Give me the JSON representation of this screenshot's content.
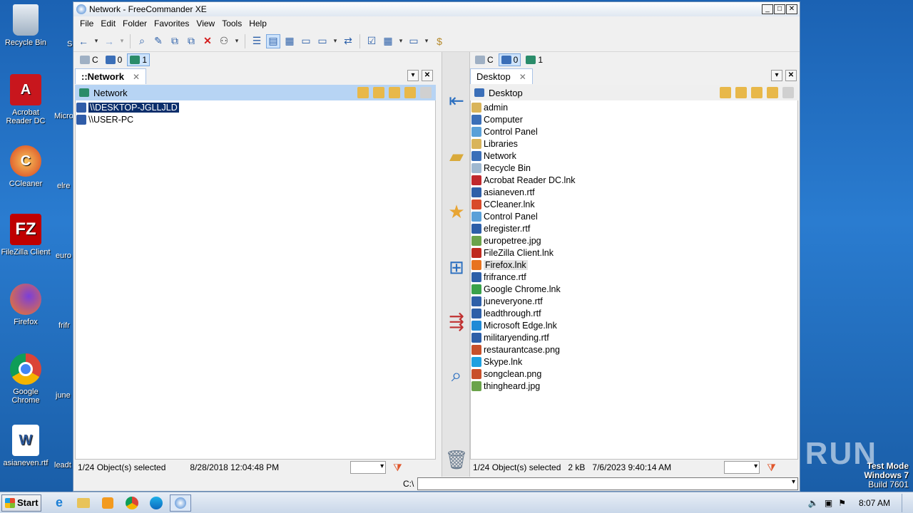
{
  "desktop": {
    "icons": [
      {
        "label": "Recycle Bin",
        "icon": "recycle-bin-icon"
      },
      {
        "label": "Acrobat Reader DC",
        "icon": "acrobat-icon"
      },
      {
        "label": "CCleaner",
        "icon": "ccleaner-icon"
      },
      {
        "label": "FileZilla Client",
        "icon": "filezilla-icon"
      },
      {
        "label": "Firefox",
        "icon": "firefox-icon"
      },
      {
        "label": "Google Chrome",
        "icon": "chrome-icon"
      },
      {
        "label": "asianeven.rtf",
        "icon": "word-doc-icon"
      }
    ],
    "partial_labels": [
      "S",
      "Micro",
      "elre",
      "euro",
      "frifr",
      "june",
      "leadt"
    ],
    "watermark": "ANY RUN",
    "testmode": {
      "line1": "Test Mode",
      "line2": "Windows 7",
      "line3": "Build 7601"
    }
  },
  "window": {
    "title": "Network - FreeCommander XE",
    "controls": {
      "minimize": "_",
      "maximize": "□",
      "close": "✕"
    },
    "menu": [
      "File",
      "Edit",
      "Folder",
      "Favorites",
      "View",
      "Tools",
      "Help"
    ]
  },
  "left": {
    "drives": [
      {
        "label": "C",
        "icon": "hard-drive-icon"
      },
      {
        "label": "0",
        "icon": "desktop-icon"
      },
      {
        "label": "1",
        "icon": "network-icon"
      }
    ],
    "tab": "::Network",
    "path": "Network",
    "items": [
      {
        "name": "\\\\DESKTOP-JGLLJLD",
        "color": "#2f5ca8",
        "selected": true
      },
      {
        "name": "\\\\USER-PC",
        "color": "#2f5ca8",
        "selected": false
      }
    ],
    "status": {
      "selected": "1/24 Object(s) selected",
      "date": "8/28/2018 12:04:48 PM"
    }
  },
  "right": {
    "drives": [
      {
        "label": "C",
        "icon": "hard-drive-icon"
      },
      {
        "label": "0",
        "icon": "desktop-icon"
      },
      {
        "label": "1",
        "icon": "network-icon"
      }
    ],
    "tab": "Desktop",
    "path": "Desktop",
    "items": [
      {
        "name": "admin",
        "color": "#d9b45a"
      },
      {
        "name": "Computer",
        "color": "#3b6fb8"
      },
      {
        "name": "Control Panel",
        "color": "#5aa0d8"
      },
      {
        "name": "Libraries",
        "color": "#d9b45a"
      },
      {
        "name": "Network",
        "color": "#3b6fb8"
      },
      {
        "name": "Recycle Bin",
        "color": "#9fb8d0"
      },
      {
        "name": "Acrobat Reader DC.lnk",
        "color": "#c0282d"
      },
      {
        "name": "asianeven.rtf",
        "color": "#2d5fa8"
      },
      {
        "name": "CCleaner.lnk",
        "color": "#d84a2a"
      },
      {
        "name": "Control Panel",
        "color": "#5aa0d8"
      },
      {
        "name": "elregister.rtf",
        "color": "#2d5fa8"
      },
      {
        "name": "europetree.jpg",
        "color": "#6aa34a"
      },
      {
        "name": "FileZilla Client.lnk",
        "color": "#bf2a1f"
      },
      {
        "name": "Firefox.lnk",
        "color": "#e8731f",
        "hover": true
      },
      {
        "name": "frifrance.rtf",
        "color": "#2d5fa8"
      },
      {
        "name": "Google Chrome.lnk",
        "color": "#3aa24a"
      },
      {
        "name": "juneveryone.rtf",
        "color": "#2d5fa8"
      },
      {
        "name": "leadthrough.rtf",
        "color": "#2d5fa8"
      },
      {
        "name": "Microsoft Edge.lnk",
        "color": "#1e8ad6"
      },
      {
        "name": "militaryending.rtf",
        "color": "#2d5fa8"
      },
      {
        "name": "restaurantcase.png",
        "color": "#c8502a"
      },
      {
        "name": "Skype.lnk",
        "color": "#1ea0e0"
      },
      {
        "name": "songclean.png",
        "color": "#c8502a"
      },
      {
        "name": "thingheard.jpg",
        "color": "#6aa34a"
      }
    ],
    "status": {
      "selected": "1/24 Object(s) selected",
      "size": "2 kB",
      "date": "7/6/2023 9:40:14 AM"
    }
  },
  "cmdline": {
    "prompt": "C:\\"
  },
  "taskbar": {
    "start": "Start",
    "clock": "8:07 AM"
  },
  "colors": {
    "accent": "#b7d4f4",
    "selection": "#0b2e6b"
  }
}
